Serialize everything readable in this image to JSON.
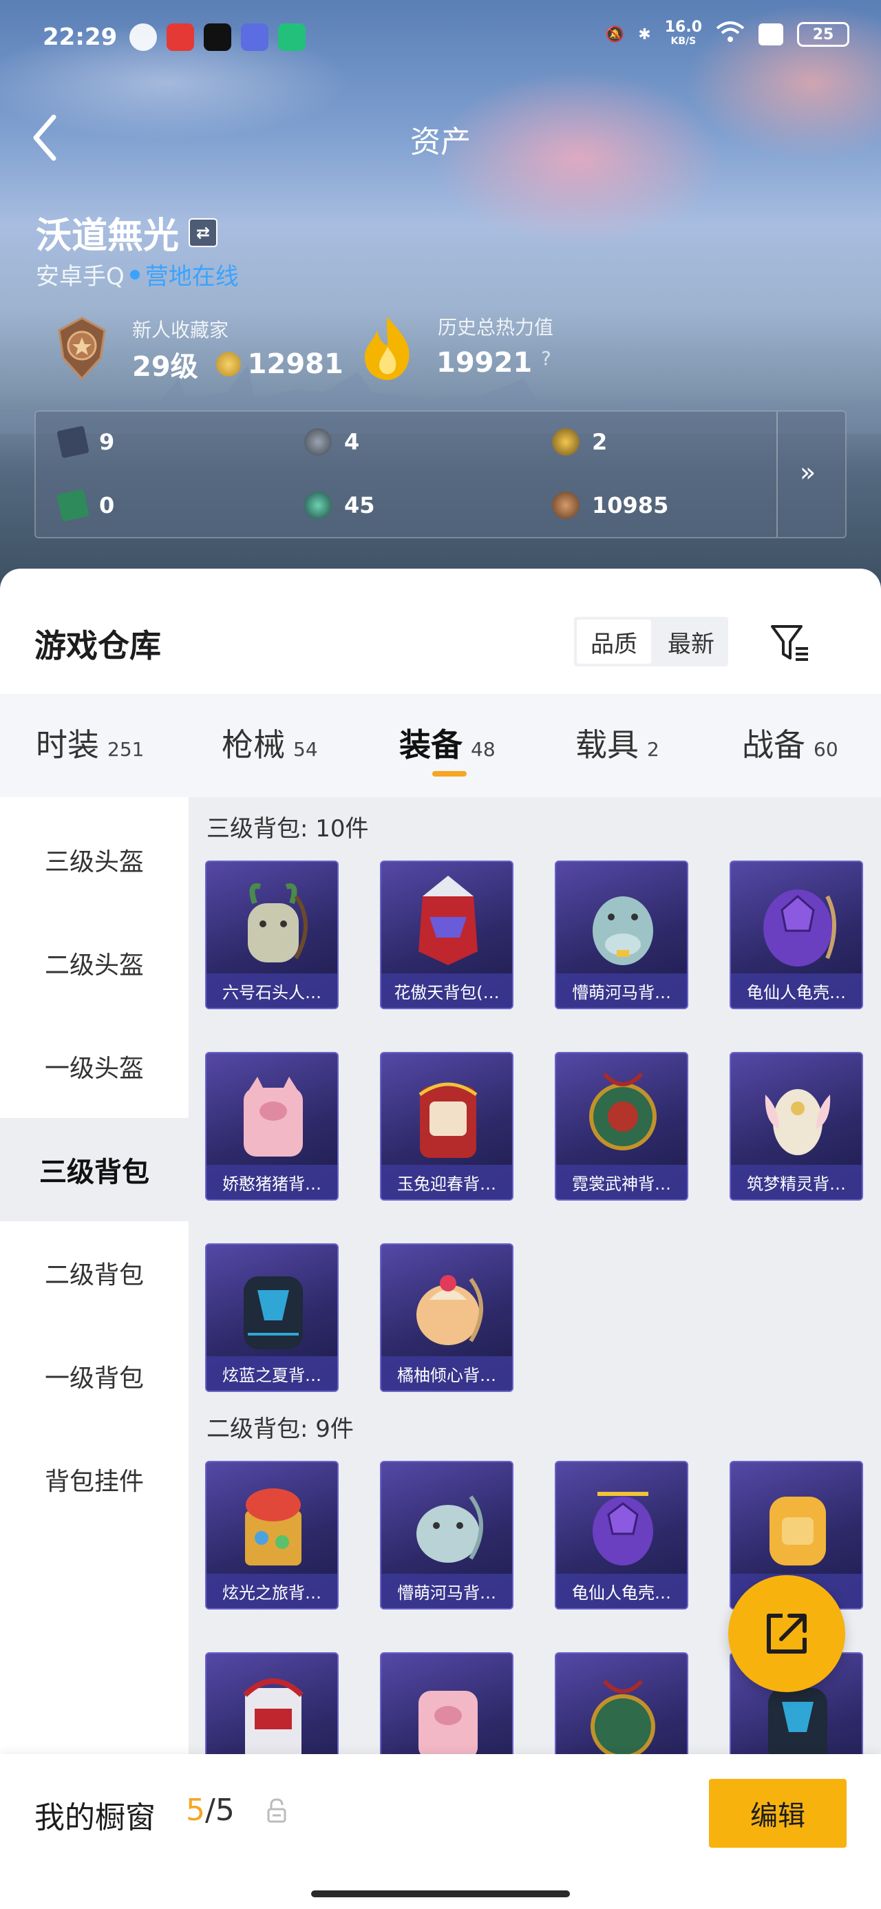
{
  "status_bar": {
    "time": "22:29",
    "speed": "16.0",
    "speed_unit": "KB/S",
    "battery": "25"
  },
  "header": {
    "title": "资产"
  },
  "profile": {
    "name": "沃道無光",
    "platform": "安卓手Q",
    "online_status": "营地在线",
    "collector_label": "新人收藏家",
    "level": "29级",
    "coins": "12981",
    "heat_label": "历史总热力值",
    "heat_value": "19921",
    "heat_help": "?"
  },
  "resources": [
    {
      "icon": "card-icon",
      "value": "9"
    },
    {
      "icon": "silver-medal-icon",
      "value": "4"
    },
    {
      "icon": "gold-medal-icon",
      "value": "2"
    },
    {
      "icon": "green-card-icon",
      "value": "0"
    },
    {
      "icon": "teal-orb-icon",
      "value": "45"
    },
    {
      "icon": "bronze-coin-icon",
      "value": "10985"
    }
  ],
  "warehouse": {
    "title": "游戏仓库",
    "sort_options": [
      "品质",
      "最新"
    ],
    "sort_selected": "品质"
  },
  "tabs": [
    {
      "label": "时装",
      "count": "251"
    },
    {
      "label": "枪械",
      "count": "54"
    },
    {
      "label": "装备",
      "count": "48",
      "active": true
    },
    {
      "label": "载具",
      "count": "2"
    },
    {
      "label": "战备",
      "count": "60"
    }
  ],
  "sidebar": [
    {
      "label": "三级头盔"
    },
    {
      "label": "二级头盔"
    },
    {
      "label": "一级头盔"
    },
    {
      "label": "三级背包",
      "selected": true
    },
    {
      "label": "二级背包"
    },
    {
      "label": "一级背包"
    },
    {
      "label": "背包挂件"
    }
  ],
  "sections": [
    {
      "title": "三级背包: 10件",
      "items": [
        {
          "name": "六号石头人…"
        },
        {
          "name": "花傲天背包(…"
        },
        {
          "name": "懵萌河马背…"
        },
        {
          "name": "龟仙人龟壳…"
        },
        {
          "name": "娇憨猪猪背…"
        },
        {
          "name": "玉兔迎春背…"
        },
        {
          "name": "霓裳武神背…"
        },
        {
          "name": "筑梦精灵背…"
        },
        {
          "name": "炫蓝之夏背…"
        },
        {
          "name": "橘柚倾心背…"
        }
      ]
    },
    {
      "title": "二级背包: 9件",
      "items": [
        {
          "name": "炫光之旅背…"
        },
        {
          "name": "懵萌河马背…"
        },
        {
          "name": "龟仙人龟壳…"
        },
        {
          "name": ""
        },
        {
          "name": ""
        },
        {
          "name": ""
        },
        {
          "name": ""
        },
        {
          "name": ""
        }
      ]
    }
  ],
  "showcase": {
    "label": "我的橱窗",
    "used": "5",
    "total": "/5",
    "edit_label": "编辑"
  },
  "colors": {
    "accent": "#f7b20e",
    "online": "#3aa3ff",
    "card_bg": "#3b3486"
  }
}
